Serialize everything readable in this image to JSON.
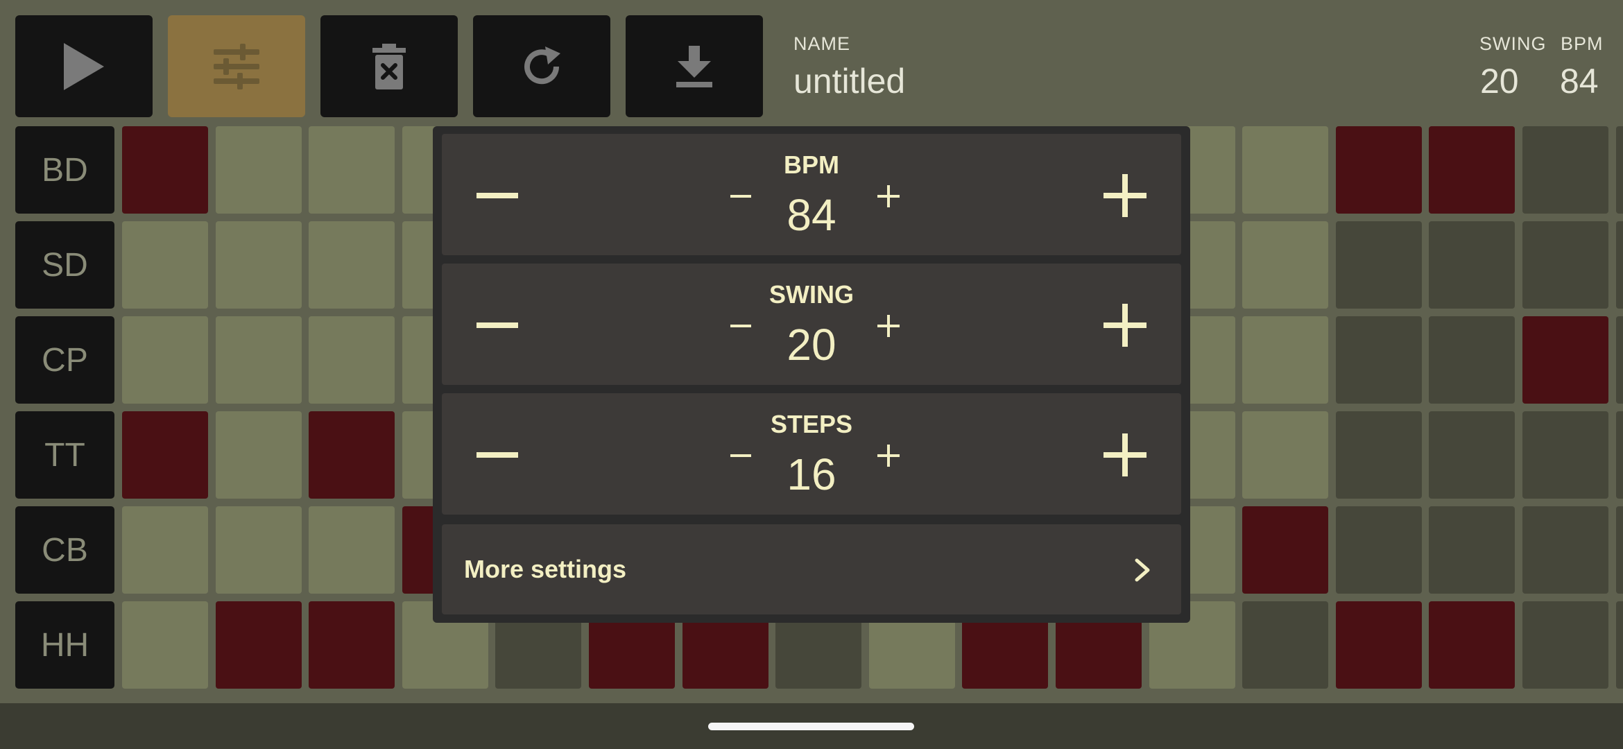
{
  "toolbar": {
    "buttons": [
      {
        "name": "play-button",
        "icon": "play-icon"
      },
      {
        "name": "mixer-button",
        "icon": "sliders-icon",
        "active": true
      },
      {
        "name": "clear-button",
        "icon": "trash-x-icon"
      },
      {
        "name": "reload-button",
        "icon": "refresh-icon"
      },
      {
        "name": "download-button",
        "icon": "download-icon"
      }
    ]
  },
  "header": {
    "name_label": "NAME",
    "name_value": "untitled",
    "swing_label": "SWING",
    "swing_value": "20",
    "bpm_label": "BPM",
    "bpm_value": "84"
  },
  "tracks": [
    "BD",
    "SD",
    "CP",
    "TT",
    "CB",
    "HH"
  ],
  "pattern": [
    [
      1,
      0,
      0,
      0,
      0,
      1,
      0,
      0,
      0,
      0,
      1,
      0,
      0,
      1,
      1,
      2,
      2
    ],
    [
      0,
      0,
      0,
      0,
      0,
      0,
      0,
      0,
      0,
      0,
      0,
      0,
      0,
      2,
      2,
      2,
      2
    ],
    [
      0,
      0,
      0,
      0,
      0,
      0,
      0,
      0,
      0,
      0,
      0,
      0,
      0,
      2,
      2,
      1,
      2
    ],
    [
      1,
      0,
      1,
      0,
      0,
      0,
      0,
      0,
      0,
      0,
      0,
      0,
      0,
      2,
      2,
      2,
      2
    ],
    [
      0,
      0,
      0,
      1,
      0,
      0,
      0,
      0,
      0,
      0,
      0,
      0,
      1,
      2,
      2,
      2,
      2
    ],
    [
      0,
      1,
      1,
      0,
      2,
      1,
      1,
      2,
      0,
      1,
      1,
      0,
      2,
      1,
      1,
      2,
      2
    ]
  ],
  "popup": {
    "rows": [
      {
        "label": "BPM",
        "value": "84"
      },
      {
        "label": "SWING",
        "value": "20"
      },
      {
        "label": "STEPS",
        "value": "16"
      }
    ],
    "more_settings": "More settings"
  },
  "colors": {
    "background": "#5f614f",
    "step_off": "#767a5c",
    "step_on": "#4a1014",
    "step_dim": "#46473a",
    "accent": "#8b7240",
    "popup_text": "#f3efc3"
  }
}
